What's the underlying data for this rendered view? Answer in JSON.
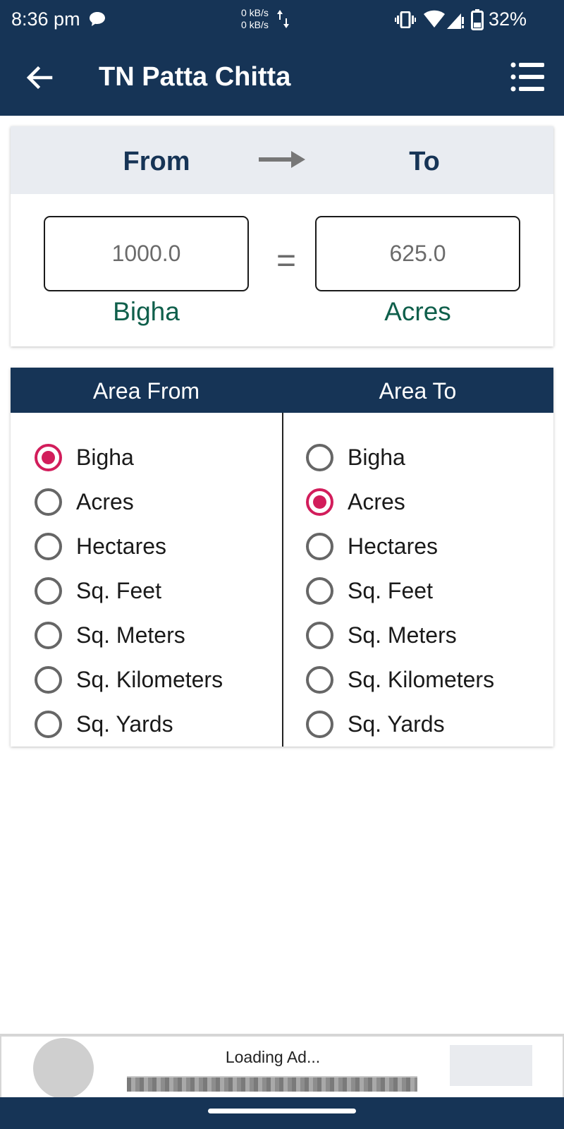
{
  "status_bar": {
    "time": "8:36 pm",
    "net_up": "0 kB/s",
    "net_down": "0 kB/s",
    "battery": "32%"
  },
  "app_bar": {
    "title": "TN Patta Chitta",
    "back_icon": "arrow-left-icon",
    "menu_icon": "list-menu-icon"
  },
  "converter": {
    "from_heading": "From",
    "to_heading": "To",
    "from_value": "1000.0",
    "to_value": "625.0",
    "equals": "=",
    "from_unit": "Bigha",
    "to_unit": "Acres"
  },
  "selector": {
    "from_title": "Area From",
    "to_title": "Area To",
    "from_options": [
      {
        "label": "Bigha",
        "checked": true
      },
      {
        "label": "Acres",
        "checked": false
      },
      {
        "label": "Hectares",
        "checked": false
      },
      {
        "label": "Sq. Feet",
        "checked": false
      },
      {
        "label": "Sq. Meters",
        "checked": false
      },
      {
        "label": "Sq. Kilometers",
        "checked": false
      },
      {
        "label": "Sq. Yards",
        "checked": false
      }
    ],
    "to_options": [
      {
        "label": "Bigha",
        "checked": false
      },
      {
        "label": "Acres",
        "checked": true
      },
      {
        "label": "Hectares",
        "checked": false
      },
      {
        "label": "Sq. Feet",
        "checked": false
      },
      {
        "label": "Sq. Meters",
        "checked": false
      },
      {
        "label": "Sq. Kilometers",
        "checked": false
      },
      {
        "label": "Sq. Yards",
        "checked": false
      }
    ]
  },
  "ad": {
    "loading_text": "Loading Ad..."
  },
  "colors": {
    "primary": "#163456",
    "accent": "#d21d5b",
    "unit_text": "#0f5f4b"
  }
}
